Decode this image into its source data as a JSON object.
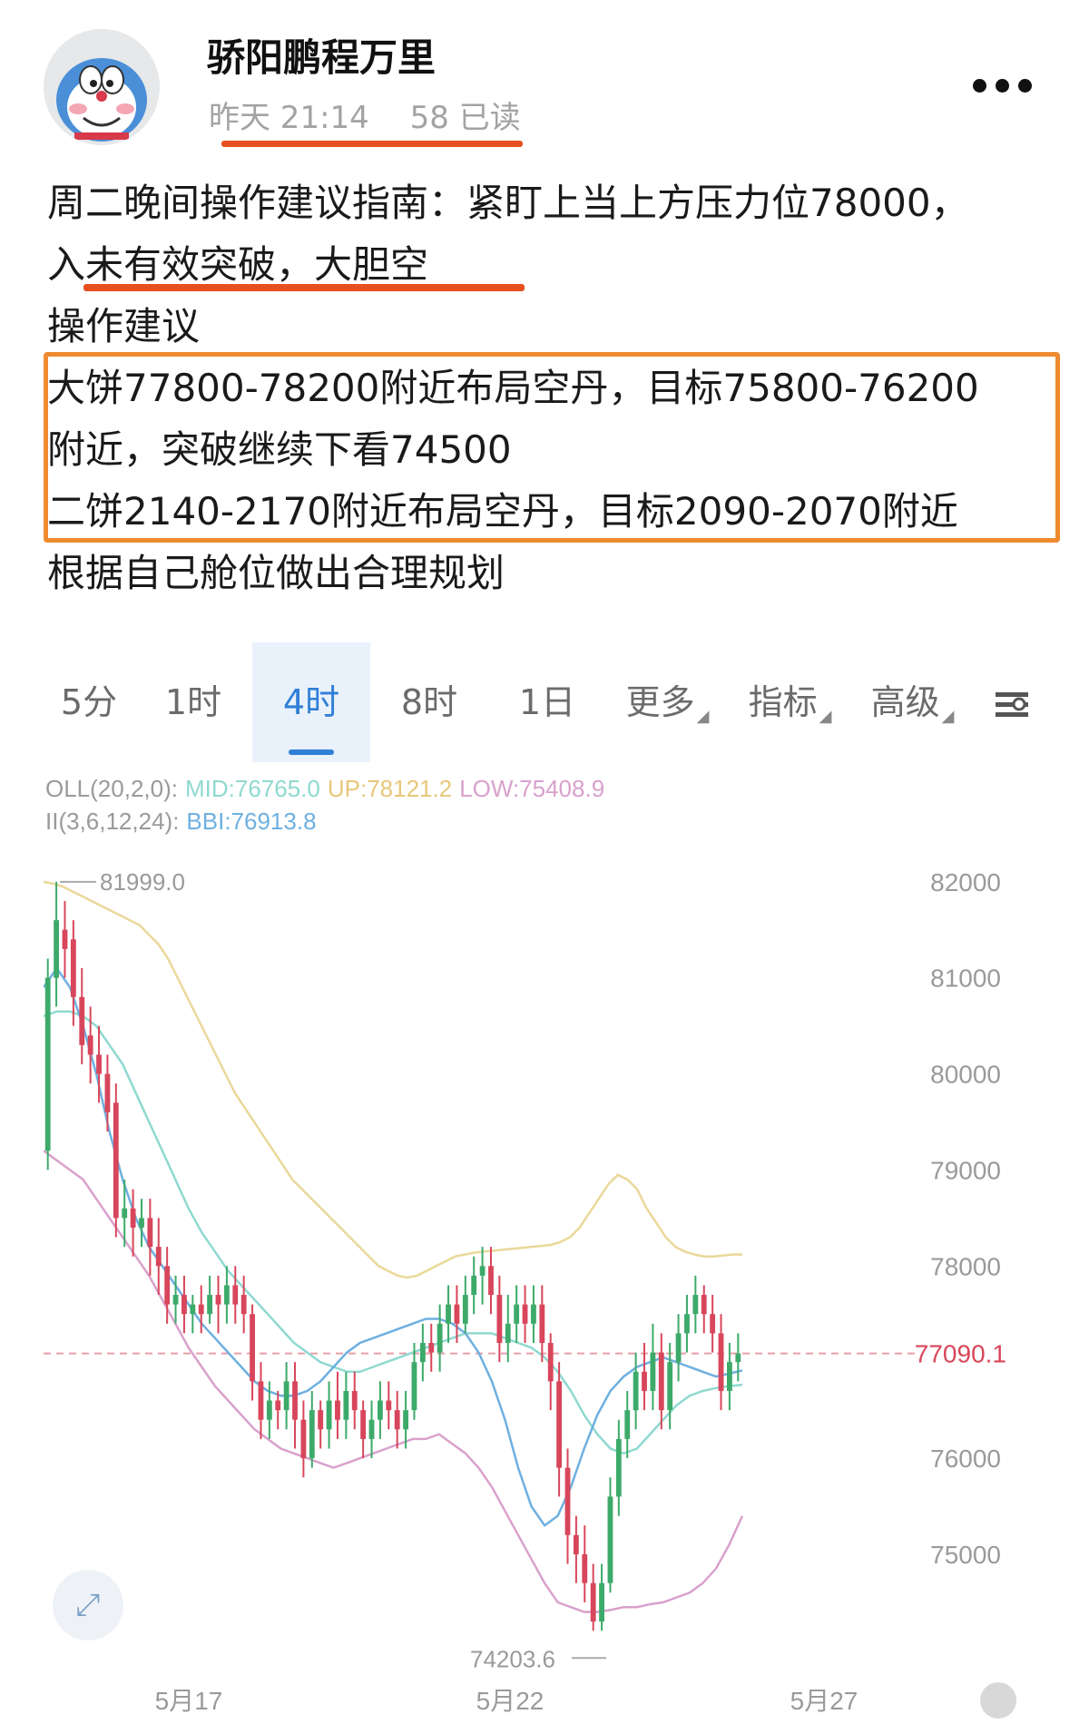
{
  "post": {
    "author": "骄阳鹏程万里",
    "time": "昨天 21:14",
    "reads": "58 已读",
    "lines": [
      "周二晚间操作建议指南：紧盯上当上方压力位78000，",
      "入未有效突破，大胆空",
      "操作建议",
      "大饼77800-78200附近布局空丹，目标75800-76200",
      "附近，突破继续下看74500",
      "二饼2140-2170附近布局空丹，目标2090-2070附近",
      "根据自己舱位做出合理规划"
    ]
  },
  "chart": {
    "tabs": [
      {
        "label": "5分",
        "dropdown": false
      },
      {
        "label": "1时",
        "dropdown": false
      },
      {
        "label": "4时",
        "dropdown": false
      },
      {
        "label": "8时",
        "dropdown": false
      },
      {
        "label": "1日",
        "dropdown": false
      },
      {
        "label": "更多",
        "dropdown": true
      },
      {
        "label": "指标",
        "dropdown": true
      },
      {
        "label": "高级",
        "dropdown": true
      }
    ],
    "active_tab": "4时",
    "boll_header": {
      "prefix": "OLL(20,2,0):",
      "mid": "MID:76765.0",
      "up": "UP:78121.2",
      "low": "LOW:75408.9"
    },
    "bbi_header": {
      "prefix": "II(3,6,12,24):",
      "bbi": "BBI:76913.8"
    },
    "colors": {
      "up_candle": "#3daa6a",
      "down_candle": "#d8465b",
      "mid": "#8fd9d0",
      "upper": "#ead89a",
      "lower": "#d9a1cc",
      "bbi": "#6eb0e0",
      "tab_active": "#2f7fd6"
    }
  },
  "chart_data": {
    "type": "candlestick",
    "title": "",
    "xlabel": "",
    "ylabel": "",
    "ylim": [
      73800,
      82300
    ],
    "y_ticks": [
      82000,
      81000,
      80000,
      79000,
      78000,
      76000,
      75000
    ],
    "y_tick_labels": [
      "82000",
      "81000",
      "80000",
      "79000",
      "78000",
      "76000",
      "75000"
    ],
    "x_tick_labels": [
      "5月17",
      "5月22",
      "5月27"
    ],
    "current_price": "77090.1",
    "current_price_value": 77090,
    "high_annotation": "81999.0",
    "high_value": 81999,
    "low_annotation": "74203.6",
    "low_value": 74203.6,
    "candles": [
      [
        79200,
        81000,
        79000,
        81200
      ],
      [
        81000,
        81600,
        80700,
        82000
      ],
      [
        81500,
        81300,
        81000,
        81800
      ],
      [
        81400,
        80800,
        80500,
        81600
      ],
      [
        80800,
        80300,
        80100,
        81100
      ],
      [
        80400,
        80200,
        79900,
        80700
      ],
      [
        80200,
        80000,
        79700,
        80500
      ],
      [
        80000,
        79600,
        79400,
        80200
      ],
      [
        79700,
        78500,
        78300,
        79900
      ],
      [
        78500,
        78600,
        78200,
        78900
      ],
      [
        78600,
        78400,
        78100,
        78800
      ],
      [
        78400,
        78500,
        78200,
        78700
      ],
      [
        78500,
        78200,
        77900,
        78700
      ],
      [
        78200,
        78000,
        77700,
        78500
      ],
      [
        78000,
        77600,
        77400,
        78200
      ],
      [
        77600,
        77700,
        77400,
        77900
      ],
      [
        77700,
        77500,
        77300,
        77900
      ],
      [
        77500,
        77600,
        77300,
        77700
      ],
      [
        77600,
        77500,
        77300,
        77800
      ],
      [
        77500,
        77700,
        77400,
        77900
      ],
      [
        77700,
        77600,
        77300,
        77900
      ],
      [
        77600,
        77800,
        77400,
        78000
      ],
      [
        77800,
        77600,
        77400,
        78000
      ],
      [
        77700,
        77500,
        77300,
        77900
      ],
      [
        77500,
        76800,
        76600,
        77600
      ],
      [
        76800,
        76400,
        76200,
        77000
      ],
      [
        76400,
        76600,
        76200,
        76800
      ],
      [
        76600,
        76500,
        76300,
        76700
      ],
      [
        76500,
        76800,
        76300,
        77000
      ],
      [
        76800,
        76400,
        76100,
        77000
      ],
      [
        76400,
        76000,
        75800,
        76600
      ],
      [
        76000,
        76500,
        75900,
        76700
      ],
      [
        76500,
        76300,
        76100,
        76600
      ],
      [
        76300,
        76600,
        76100,
        76800
      ],
      [
        76600,
        76400,
        76200,
        76900
      ],
      [
        76400,
        76700,
        76200,
        76900
      ],
      [
        76700,
        76500,
        76300,
        76900
      ],
      [
        76500,
        76200,
        76000,
        76600
      ],
      [
        76200,
        76400,
        76000,
        76600
      ],
      [
        76400,
        76600,
        76200,
        76800
      ],
      [
        76600,
        76500,
        76300,
        76800
      ],
      [
        76500,
        76300,
        76100,
        76700
      ],
      [
        76300,
        76500,
        76100,
        76700
      ],
      [
        76500,
        77000,
        76400,
        77200
      ],
      [
        77000,
        77200,
        76800,
        77400
      ],
      [
        77200,
        77100,
        76900,
        77400
      ],
      [
        77100,
        77400,
        76900,
        77600
      ],
      [
        77400,
        77600,
        77200,
        77800
      ],
      [
        77600,
        77400,
        77200,
        77800
      ],
      [
        77400,
        77700,
        77300,
        77900
      ],
      [
        77700,
        77900,
        77500,
        78100
      ],
      [
        77900,
        78000,
        77600,
        78200
      ],
      [
        78000,
        77700,
        77500,
        78200
      ],
      [
        77700,
        77200,
        77000,
        77900
      ],
      [
        77200,
        77400,
        77000,
        77700
      ],
      [
        77400,
        77600,
        77200,
        77800
      ],
      [
        77600,
        77400,
        77200,
        77800
      ],
      [
        77400,
        77600,
        77200,
        77800
      ],
      [
        77600,
        77200,
        77000,
        77800
      ],
      [
        77200,
        76800,
        76500,
        77300
      ],
      [
        76800,
        75900,
        75600,
        77000
      ],
      [
        75900,
        75200,
        74900,
        76100
      ],
      [
        75200,
        75000,
        74700,
        75400
      ],
      [
        75000,
        74700,
        74500,
        75300
      ],
      [
        74700,
        74300,
        74204,
        74900
      ],
      [
        74300,
        74700,
        74204,
        74900
      ],
      [
        74700,
        75600,
        74600,
        75800
      ],
      [
        75600,
        76200,
        75400,
        76400
      ],
      [
        76200,
        76500,
        76000,
        76700
      ],
      [
        76500,
        76900,
        76300,
        77100
      ],
      [
        76900,
        76700,
        76500,
        77200
      ],
      [
        76700,
        77100,
        76500,
        77400
      ],
      [
        77100,
        76500,
        76300,
        77300
      ],
      [
        76500,
        77000,
        76300,
        77200
      ],
      [
        77000,
        77300,
        76800,
        77500
      ],
      [
        77300,
        77500,
        77100,
        77700
      ],
      [
        77500,
        77700,
        77300,
        77900
      ],
      [
        77700,
        77500,
        77300,
        77800
      ],
      [
        77500,
        77300,
        77100,
        77700
      ],
      [
        77300,
        76700,
        76500,
        77500
      ],
      [
        76700,
        77000,
        76500,
        77200
      ],
      [
        77000,
        77090,
        76800,
        77300
      ]
    ],
    "series": [
      {
        "name": "UP",
        "values": [
          81999,
          81980,
          81950,
          81900,
          81850,
          81800,
          81750,
          81700,
          81650,
          81600,
          81550,
          81450,
          81350,
          81200,
          81000,
          80800,
          80600,
          80400,
          80200,
          80000,
          79800,
          79650,
          79500,
          79350,
          79200,
          79050,
          78900,
          78800,
          78700,
          78600,
          78500,
          78400,
          78300,
          78200,
          78100,
          78000,
          77950,
          77900,
          77880,
          77900,
          77950,
          78000,
          78050,
          78100,
          78120,
          78140,
          78150,
          78160,
          78170,
          78180,
          78190,
          78200,
          78210,
          78220,
          78250,
          78300,
          78400,
          78550,
          78700,
          78850,
          78950,
          78900,
          78800,
          78600,
          78450,
          78300,
          78200,
          78150,
          78120,
          78100,
          78100,
          78110,
          78120,
          78121
        ]
      },
      {
        "name": "MID",
        "values": [
          80600,
          80650,
          80650,
          80600,
          80500,
          80300,
          80100,
          79800,
          79500,
          79200,
          78900,
          78600,
          78350,
          78150,
          77950,
          77800,
          77650,
          77500,
          77350,
          77200,
          77100,
          77000,
          76950,
          76900,
          76900,
          76950,
          77000,
          77050,
          77100,
          77150,
          77200,
          77250,
          77300,
          77300,
          77300,
          77250,
          77200,
          77150,
          77050,
          76900,
          76700,
          76450,
          76250,
          76100,
          76050,
          76100,
          76250,
          76400,
          76550,
          76650,
          76700,
          76730,
          76750,
          76765
        ]
      },
      {
        "name": "LOW",
        "values": [
          79200,
          79100,
          79000,
          78900,
          78700,
          78500,
          78300,
          78100,
          77900,
          77650,
          77400,
          77150,
          76950,
          76750,
          76600,
          76450,
          76300,
          76200,
          76100,
          76050,
          76000,
          75950,
          75900,
          75950,
          76000,
          76050,
          76100,
          76150,
          76200,
          76200,
          76250,
          76150,
          76050,
          75900,
          75700,
          75450,
          75200,
          74950,
          74700,
          74500,
          74450,
          74400,
          74400,
          74420,
          74450,
          74450,
          74480,
          74500,
          74550,
          74600,
          74700,
          74850,
          75100,
          75400
        ]
      },
      {
        "name": "BBI",
        "values": [
          80900,
          81100,
          80900,
          80500,
          80000,
          79400,
          78900,
          78500,
          78200,
          78000,
          77800,
          77600,
          77400,
          77250,
          77100,
          76950,
          76800,
          76700,
          76650,
          76650,
          76700,
          76800,
          76950,
          77100,
          77200,
          77250,
          77300,
          77350,
          77400,
          77450,
          77450,
          77400,
          77300,
          77100,
          76800,
          76400,
          75900,
          75500,
          75300,
          75400,
          75700,
          76100,
          76450,
          76700,
          76850,
          76950,
          77000,
          77050,
          77000,
          76950,
          76900,
          76850,
          76880,
          76914
        ]
      }
    ]
  }
}
